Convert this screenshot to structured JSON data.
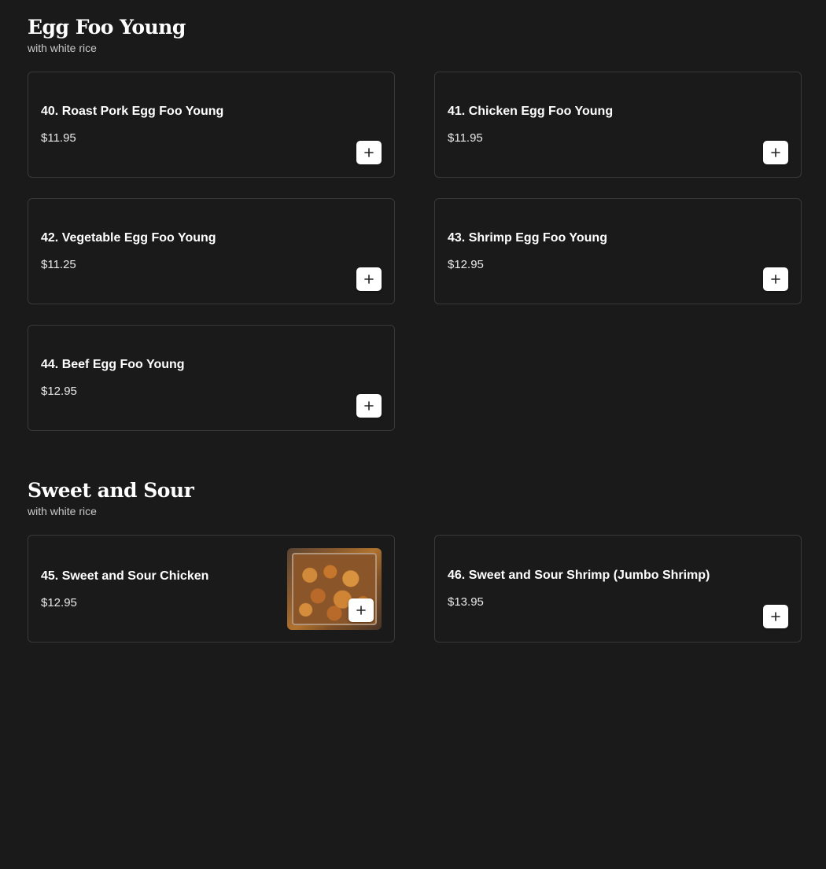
{
  "sections": [
    {
      "title": "Egg Foo Young",
      "subtitle": "with white rice",
      "items": [
        {
          "name": "40. Roast Pork Egg Foo Young",
          "price": "$11.95"
        },
        {
          "name": "41. Chicken Egg Foo Young",
          "price": "$11.95"
        },
        {
          "name": "42. Vegetable Egg Foo Young",
          "price": "$11.25"
        },
        {
          "name": "43. Shrimp Egg Foo Young",
          "price": "$12.95"
        },
        {
          "name": "44. Beef Egg Foo Young",
          "price": "$12.95"
        }
      ]
    },
    {
      "title": "Sweet and Sour",
      "subtitle": "with white rice",
      "items": [
        {
          "name": "45. Sweet and Sour Chicken",
          "price": "$12.95",
          "has_image": true
        },
        {
          "name": "46. Sweet and Sour Shrimp (Jumbo Shrimp)",
          "price": "$13.95"
        }
      ]
    }
  ],
  "icons": {
    "add": "plus-icon"
  },
  "colors": {
    "background": "#1b1a1b",
    "card_border": "#3a393a",
    "button_bg": "#ffffff",
    "text": "#ffffff"
  }
}
